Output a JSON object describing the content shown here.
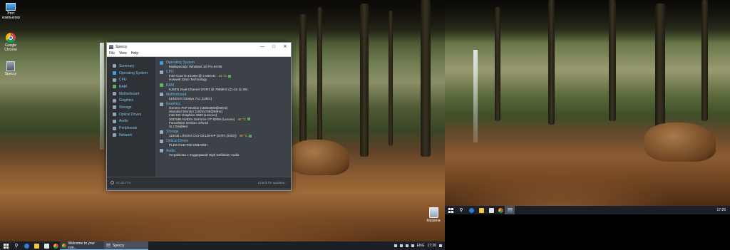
{
  "desktop": {
    "icons": [
      {
        "label_line1": "Этот",
        "label_line2": "компьютер",
        "icon": "this-pc-icon"
      },
      {
        "label_line1": "Google",
        "label_line2": "Chrome",
        "icon": "chrome-icon"
      },
      {
        "label_line1": "Speccy",
        "label_line2": "",
        "icon": "speccy-icon"
      }
    ],
    "recycle_bin_label": "Корзина"
  },
  "speccy": {
    "title": "Speccy",
    "menu": [
      "File",
      "View",
      "Help"
    ],
    "nav": [
      {
        "label": "Summary",
        "icon": "summary-icon"
      },
      {
        "label": "Operating System",
        "icon": "windows-icon"
      },
      {
        "label": "CPU",
        "icon": "cpu-icon"
      },
      {
        "label": "RAM",
        "icon": "ram-icon"
      },
      {
        "label": "Motherboard",
        "icon": "motherboard-icon"
      },
      {
        "label": "Graphics",
        "icon": "graphics-icon"
      },
      {
        "label": "Storage",
        "icon": "storage-icon"
      },
      {
        "label": "Optical Drives",
        "icon": "optical-drive-icon"
      },
      {
        "label": "Audio",
        "icon": "audio-icon"
      },
      {
        "label": "Peripherals",
        "icon": "peripherals-icon"
      },
      {
        "label": "Network",
        "icon": "network-icon"
      }
    ],
    "sections": {
      "os": {
        "heading": "Operating System",
        "lines": [
          "Майкрософт Windows 10 Pro 64-bit"
        ]
      },
      "cpu": {
        "heading": "CPU",
        "lines": [
          "Intel Core i5 4210M @ 2.60GHz",
          "Haswell 22nm Technology"
        ],
        "temp": "41 °C"
      },
      "ram": {
        "heading": "RAM",
        "lines": [
          "8,00ГБ Dual-Channel DDR3 @ 798MHz (11-11-11-28)"
        ]
      },
      "motherboard": {
        "heading": "Motherboard",
        "lines": [
          "LENOVO Giraiya 7A1 (U3E1)"
        ]
      },
      "graphics": {
        "heading": "Graphics",
        "lines": [
          "Generic PnP Monitor (1600x900@60Hz)",
          "Standard Monitor (1024x768@60Hz)",
          "Intel HD Graphics 4600 (Lenovo)",
          "2047MB NVIDIA GeForce GT 820M (Lenovo)",
          "ForceWare version: 376.54",
          "SLI Disabled"
        ],
        "temp": "40 °C"
      },
      "storage": {
        "heading": "Storage",
        "lines": [
          "119GB LITEON CV3-CE128-HP (SATA (SSD))"
        ],
        "temp": "48 °C"
      },
      "optical": {
        "heading": "Optical Drives",
        "lines": [
          "PLDS DVD-RW DS8A8SH"
        ]
      },
      "audio": {
        "heading": "Audio",
        "lines": [
          "Устройство с поддержкой High Definition Audio"
        ]
      }
    },
    "version": "v1.32.774",
    "check_updates": "Check for updates..."
  },
  "taskbar1": {
    "tasks": [
      {
        "label": "Welcome to your con...",
        "icon": "chrome-icon"
      },
      {
        "label": "Speccy",
        "icon": "speccy-icon"
      }
    ],
    "lang": "ENG",
    "time": "17:26"
  },
  "taskbar2": {
    "time": "17:26"
  }
}
